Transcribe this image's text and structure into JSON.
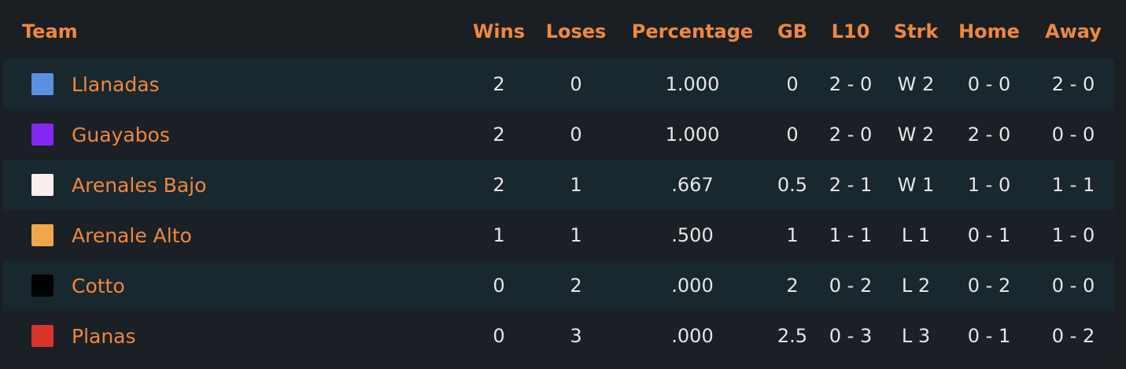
{
  "columns": {
    "team": "Team",
    "wins": "Wins",
    "loses": "Loses",
    "percentage": "Percentage",
    "gb": "GB",
    "l10": "L10",
    "strk": "Strk",
    "home": "Home",
    "away": "Away"
  },
  "colors": {
    "accent": "#f0883a",
    "text": "#e6e6e6",
    "row_odd": "#19272e",
    "row_even": "#1a2026"
  },
  "rows": [
    {
      "team": "Llanadas",
      "color": "#5b8fe0",
      "wins": "2",
      "loses": "0",
      "percentage": "1.000",
      "gb": "0",
      "l10": "2 - 0",
      "strk": "W 2",
      "home": "0 - 0",
      "away": "2 - 0"
    },
    {
      "team": "Guayabos",
      "color": "#8427f0",
      "wins": "2",
      "loses": "0",
      "percentage": "1.000",
      "gb": "0",
      "l10": "2 - 0",
      "strk": "W 2",
      "home": "2 - 0",
      "away": "0 - 0"
    },
    {
      "team": "Arenales Bajo",
      "color": "#f8eeee",
      "wins": "2",
      "loses": "1",
      "percentage": ".667",
      "gb": "0.5",
      "l10": "2 - 1",
      "strk": "W 1",
      "home": "1 - 0",
      "away": "1 - 1"
    },
    {
      "team": "Arenale Alto",
      "color": "#eea84a",
      "wins": "1",
      "loses": "1",
      "percentage": ".500",
      "gb": "1",
      "l10": "1 - 1",
      "strk": "L 1",
      "home": "0 - 1",
      "away": "1 - 0"
    },
    {
      "team": "Cotto",
      "color": "#000000",
      "wins": "0",
      "loses": "2",
      "percentage": ".000",
      "gb": "2",
      "l10": "0 - 2",
      "strk": "L 2",
      "home": "0 - 2",
      "away": "0 - 0"
    },
    {
      "team": "Planas",
      "color": "#d9342b",
      "wins": "0",
      "loses": "3",
      "percentage": ".000",
      "gb": "2.5",
      "l10": "0 - 3",
      "strk": "L 3",
      "home": "0 - 1",
      "away": "0 - 2"
    }
  ]
}
